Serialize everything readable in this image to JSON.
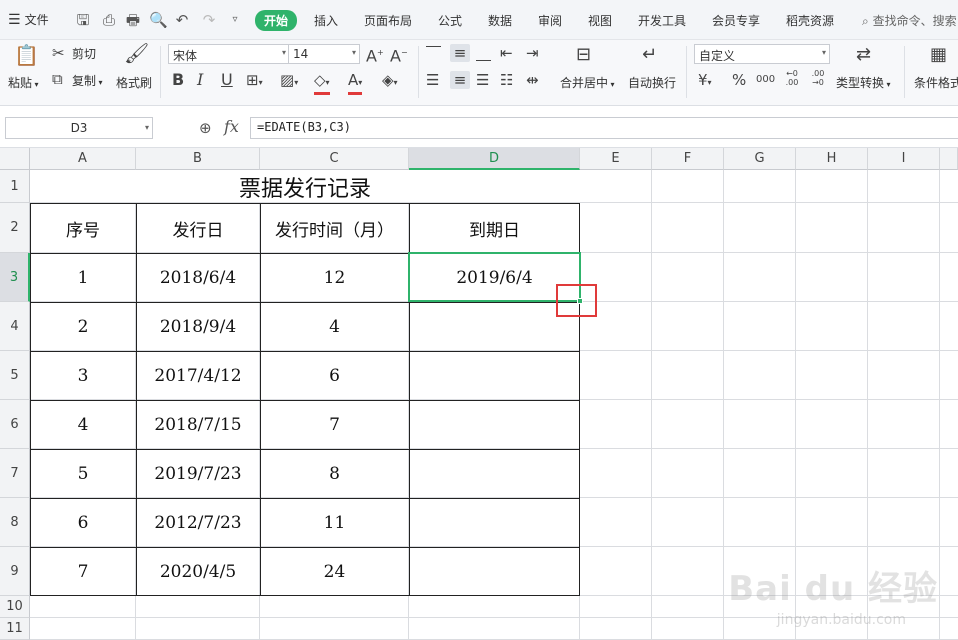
{
  "menubar": {
    "file_label": "文件",
    "tabs": [
      "开始",
      "插入",
      "页面布局",
      "公式",
      "数据",
      "审阅",
      "视图",
      "开发工具",
      "会员专享",
      "稻壳资源"
    ],
    "active_tab": "开始",
    "search_placeholder": "查找命令、搜索"
  },
  "ribbon": {
    "paste": "粘贴",
    "cut": "剪切",
    "copy": "复制",
    "format_painter": "格式刷",
    "font_name": "宋体",
    "font_size": "14",
    "merge_center": "合并居中",
    "wrap_text": "自动换行",
    "number_format": "自定义",
    "type_convert": "类型转换",
    "conditional_format": "条件格式",
    "currency_symbol": "¥",
    "percent_symbol": "%",
    "thousands_symbol": "000",
    "inc_decimal": "←0 .00",
    "dec_decimal": ".00 →0"
  },
  "formula_bar": {
    "name_box": "D3",
    "fx_label": "fx",
    "formula": "=EDATE(B3,C3)"
  },
  "sheet": {
    "columns": [
      "A",
      "B",
      "C",
      "D",
      "E",
      "F",
      "G",
      "H",
      "I"
    ],
    "rows": [
      "1",
      "2",
      "3",
      "4",
      "5",
      "6",
      "7",
      "8",
      "9",
      "10",
      "11"
    ],
    "selected_column": "D",
    "selected_row": "3",
    "title": "票据发行记录",
    "headers": [
      "序号",
      "发行日",
      "发行时间（月）",
      "到期日"
    ],
    "records": [
      [
        "1",
        "2018/6/4",
        "12",
        "2019/6/4"
      ],
      [
        "2",
        "2018/9/4",
        "4",
        ""
      ],
      [
        "3",
        "2017/4/12",
        "6",
        ""
      ],
      [
        "4",
        "2018/7/15",
        "7",
        ""
      ],
      [
        "5",
        "2019/7/23",
        "8",
        ""
      ],
      [
        "6",
        "2012/7/23",
        "11",
        ""
      ],
      [
        "7",
        "2020/4/5",
        "24",
        ""
      ]
    ]
  },
  "watermark": {
    "main": "Bai du 经验",
    "sub": "jingyan.baidu.com"
  },
  "colors": {
    "accent": "#2fb36b",
    "highlight_box": "#e03a3a"
  }
}
